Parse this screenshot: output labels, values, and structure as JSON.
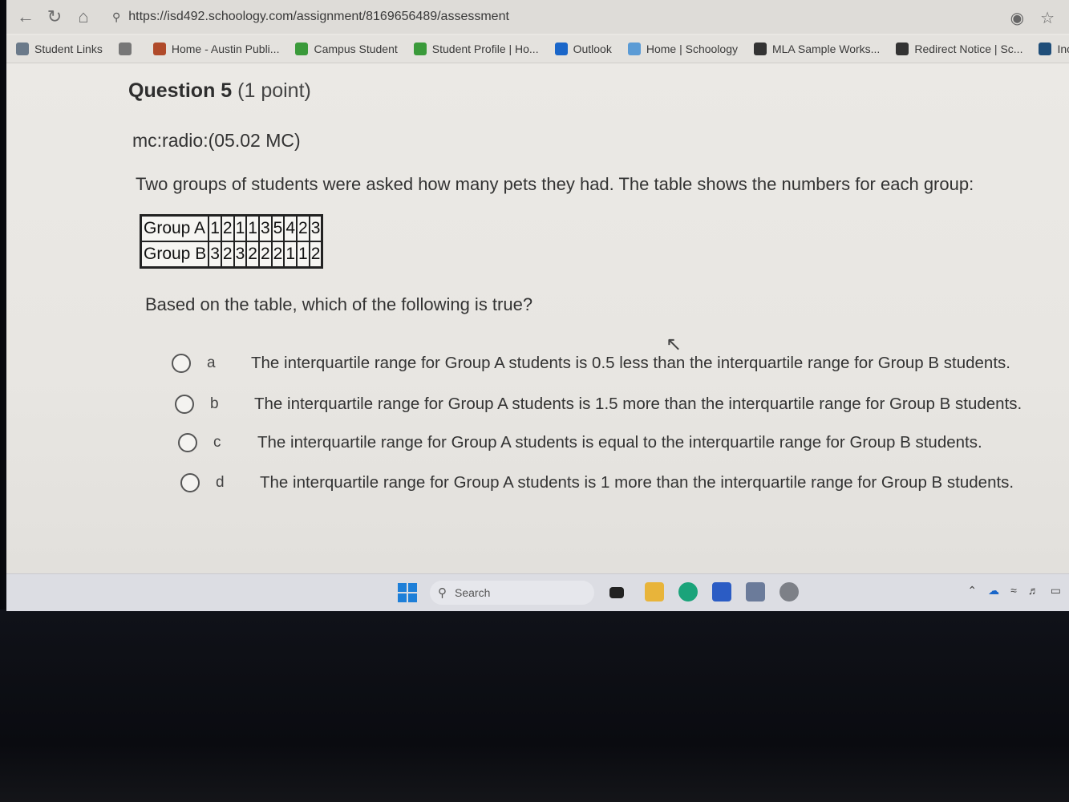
{
  "browser": {
    "url": "https://isd492.schoology.com/assignment/8169656489/assessment",
    "bookmarks": [
      {
        "label": "Student Links",
        "icon": "student-links-icon",
        "color": "#6b7a8a"
      },
      {
        "label": "",
        "icon": "reading-list-icon",
        "color": "#777777"
      },
      {
        "label": "Home - Austin Publi...",
        "icon": "district-icon",
        "color": "#b04a2a"
      },
      {
        "label": "Campus Student",
        "icon": "campus-icon",
        "color": "#3a9a3a"
      },
      {
        "label": "Student Profile | Ho...",
        "icon": "campus-icon",
        "color": "#3a9a3a"
      },
      {
        "label": "Outlook",
        "icon": "outlook-icon",
        "color": "#1a66c9"
      },
      {
        "label": "Home | Schoology",
        "icon": "schoology-icon",
        "color": "#5b9bd5"
      },
      {
        "label": "MLA Sample Works...",
        "icon": "purdue-icon",
        "color": "#333333"
      },
      {
        "label": "Redirect Notice | Sc...",
        "icon": "purdue-icon",
        "color": "#333333"
      },
      {
        "label": "Incident IQ | Tick",
        "icon": "incident-iq-icon",
        "color": "#1f4e79"
      }
    ]
  },
  "question": {
    "number_label": "Question 5",
    "points_label": "(1 point)",
    "code": "mc:radio:(05.02 MC)",
    "prompt": "Two groups of students were asked how many pets they had. The table shows the numbers for each group:",
    "ask": "Based on the table, which of the following is true?"
  },
  "table": {
    "rows": [
      {
        "label": "Group A",
        "values": [
          "1",
          "2",
          "1",
          "1",
          "3",
          "5",
          "4",
          "2",
          "3"
        ]
      },
      {
        "label": "Group B",
        "values": [
          "3",
          "2",
          "3",
          "2",
          "2",
          "2",
          "1",
          "1",
          "2"
        ]
      }
    ]
  },
  "options": [
    {
      "letter": "a",
      "text": "The interquartile range for Group A students is 0.5 less than the interquartile range for Group B students."
    },
    {
      "letter": "b",
      "text": "The interquartile range for Group A students is 1.5 more than the interquartile range for Group B students."
    },
    {
      "letter": "c",
      "text": "The interquartile range for Group A students is equal to the interquartile range for Group B students."
    },
    {
      "letter": "d",
      "text": "The interquartile range for Group A students is 1 more than the interquartile range for Group B students."
    }
  ],
  "taskbar": {
    "search_placeholder": "Search"
  }
}
